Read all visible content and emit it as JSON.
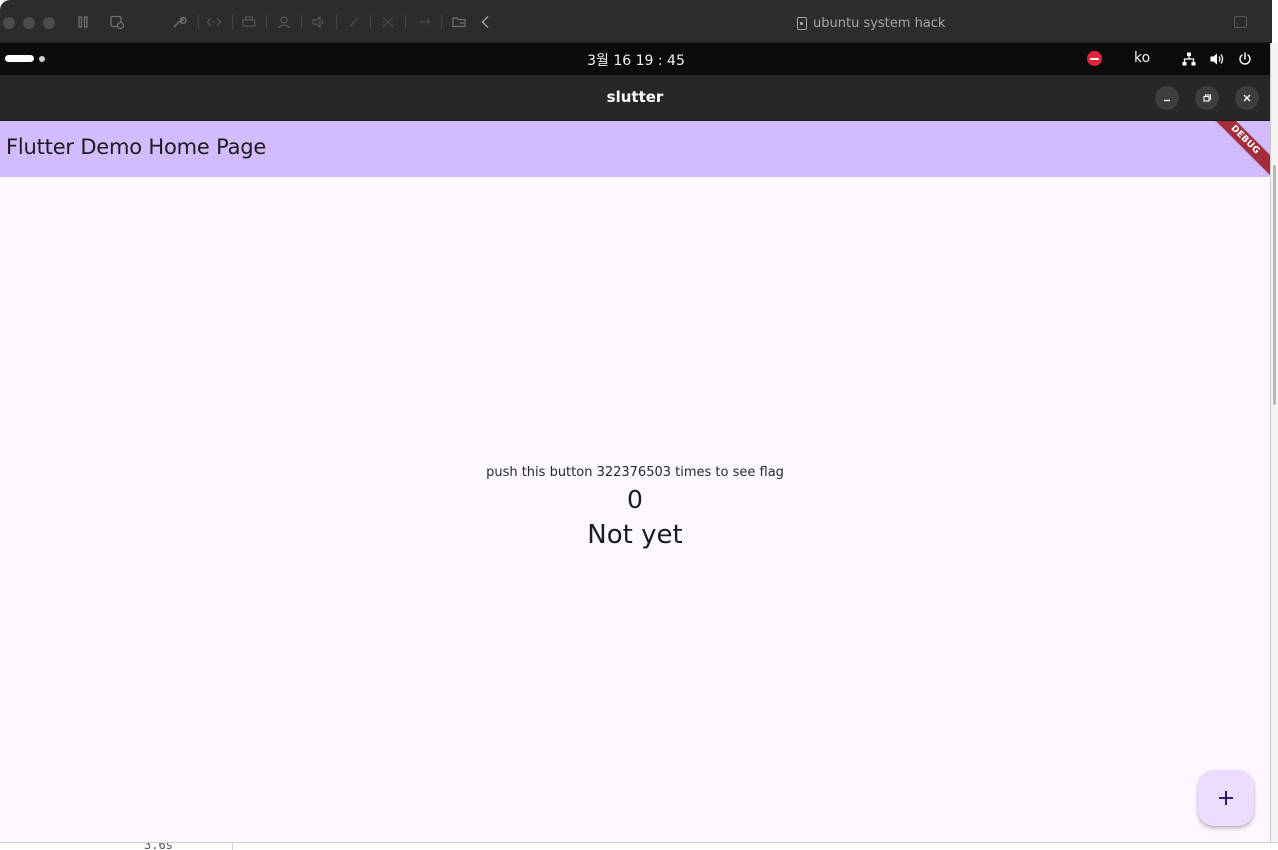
{
  "host": {
    "title": "ubuntu system hack",
    "icons": [
      "pause-icon",
      "snapshot-icon",
      "wrench-icon",
      "code-icon",
      "printer-icon",
      "user-icon",
      "audio-icon",
      "usb-icon",
      "network-icon",
      "arrow-icon",
      "folder-icon",
      "back-chevron-icon"
    ]
  },
  "panel": {
    "clock": "3월 16  19 : 45",
    "language": "ko",
    "icons": [
      "do-not-disturb-icon",
      "network-icon",
      "volume-icon",
      "power-icon"
    ],
    "dnd_color": "#e0243d"
  },
  "window": {
    "title": "slutter",
    "controls": [
      "minimize",
      "maximize",
      "close"
    ]
  },
  "app": {
    "appbar_title": "Flutter Demo Home Page",
    "appbar_color": "#d3bcfd",
    "background": "#fdf7ff",
    "debug_banner": "DEBUG",
    "message": "push this button 322376503 times to see flag",
    "counter": "0",
    "status": "Not yet",
    "fab_icon": "plus-icon",
    "fab_color": "#eaddff"
  },
  "host_background": {
    "partial_text": "3.6s"
  }
}
